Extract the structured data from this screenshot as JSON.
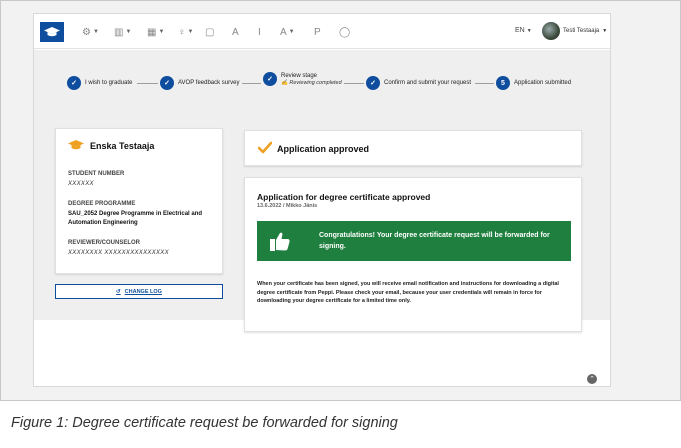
{
  "navbar": {
    "icons": [
      "compass-icon",
      "chart-icon",
      "calendar-icon",
      "bulb-icon",
      "document-icon",
      "letter-a-icon",
      "letter-i-icon",
      "letter-a2-icon",
      "letter-p-icon",
      "chat-icon"
    ],
    "letters": {
      "a": "A",
      "i": "I",
      "a2": "A",
      "p": "P"
    },
    "language": "EN",
    "user_name": "Testi Testaaja"
  },
  "steps": [
    {
      "label": "I wish to graduate"
    },
    {
      "label": "AVOP feedback survey"
    },
    {
      "label": "Review stage",
      "sublabel": "Reviewing completed"
    },
    {
      "label": "Confirm and submit your request"
    },
    {
      "number": "5",
      "label": "Application submitted"
    }
  ],
  "student": {
    "name": "Enska Testaaja",
    "student_number_label": "STUDENT NUMBER",
    "student_number_value": "XXXXXX",
    "degree_label": "DEGREE PROGRAMME",
    "degree_value": "SAU_2052 Degree Programme in Electrical and Automation Engineering",
    "reviewer_label": "REVIEWER/COUNSELOR",
    "reviewer_value": "XXXXXXXX XXXXXXXXXXXXXXX"
  },
  "changelog_label": "CHANGE LOG",
  "status": {
    "title": "Application approved"
  },
  "application": {
    "title": "Application for degree certificate approved",
    "meta": "13.6.2022 / Mikko Jänis",
    "congrats": "Congratulations! Your degree certificate request will be forwarded for signing.",
    "body": "When your certificate has been signed, you will receive email notification and instructions for downloading a digital degree certificate from Peppi. Please check your email, because your user credentials will remain in force for downloading your degree certificate for a limited time only."
  },
  "caption": "Figure 1: Degree certificate request be forwarded for signing",
  "colors": {
    "primary": "#0f4e9e",
    "success": "#1f7f3f",
    "accent_check": "#f0a020"
  }
}
